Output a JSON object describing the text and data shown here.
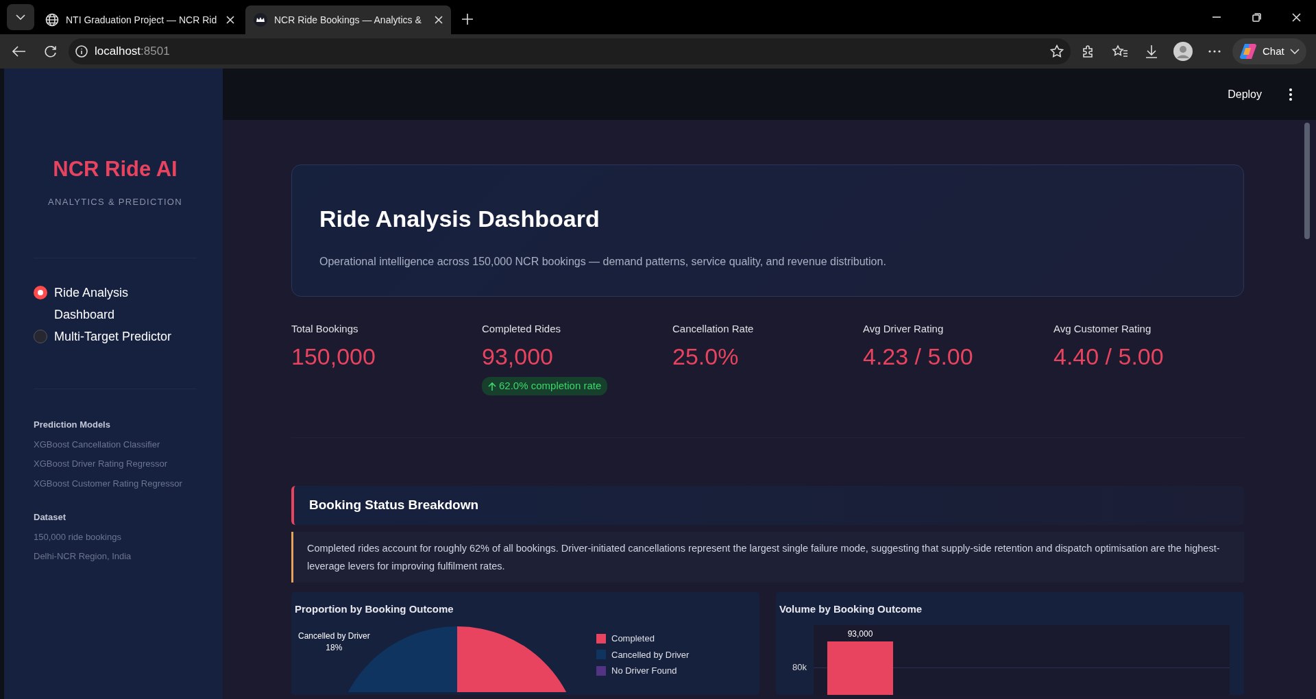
{
  "browser": {
    "tabs": [
      {
        "title": "NTI Graduation Project — NCR Rid",
        "selected": false
      },
      {
        "title": "NCR Ride Bookings — Analytics &",
        "selected": true
      }
    ],
    "url_host": "localhost",
    "url_port": ":8501",
    "chat_label": "Chat"
  },
  "toolbar": {
    "deploy": "Deploy"
  },
  "sidebar": {
    "title": "NCR Ride AI",
    "subtitle": "ANALYTICS & PREDICTION",
    "nav": [
      {
        "label": "Ride Analysis Dashboard",
        "selected": true
      },
      {
        "label": "Multi-Target Predictor",
        "selected": false
      }
    ],
    "sections": [
      {
        "heading": "Prediction Models",
        "items": [
          "XGBoost Cancellation Classifier",
          "XGBoost Driver Rating Regressor",
          "XGBoost Customer Rating Regressor"
        ]
      },
      {
        "heading": "Dataset",
        "items": [
          "150,000 ride bookings",
          "Delhi-NCR Region, India"
        ]
      }
    ]
  },
  "header": {
    "title": "Ride Analysis Dashboard",
    "subtitle": "Operational intelligence across 150,000 NCR bookings — demand patterns, service quality, and revenue distribution."
  },
  "metrics": [
    {
      "label": "Total Bookings",
      "value": "150,000"
    },
    {
      "label": "Completed Rides",
      "value": "93,000",
      "delta": {
        "text": "62.0% completion rate"
      }
    },
    {
      "label": "Cancellation Rate",
      "value": "25.0%"
    },
    {
      "label": "Avg Driver Rating",
      "value": "4.23 / 5.00"
    },
    {
      "label": "Avg Customer Rating",
      "value": "4.40 / 5.00"
    }
  ],
  "section": {
    "title": "Booking Status Breakdown",
    "note": "Completed rides account for roughly 62% of all bookings. Driver-initiated cancellations represent the largest single failure mode, suggesting that supply-side retention and dispatch optimisation are the highest-leverage levers for improving fulfilment rates."
  },
  "charts": [
    {
      "kind": "pie",
      "title": "Proportion by Booking Outcome",
      "slice_label": "Cancelled by Driver",
      "slice_value": "18%",
      "legend": [
        {
          "label": "Completed",
          "color": "#e8435f"
        },
        {
          "label": "Cancelled by Driver",
          "color": "#0f3460"
        },
        {
          "label": "No Driver Found",
          "color": "#533483"
        }
      ]
    },
    {
      "kind": "bar",
      "title": "Volume by Booking Outcome",
      "bar_label": "93,000",
      "ytick": "80k",
      "color": "#e8435f"
    }
  ]
}
